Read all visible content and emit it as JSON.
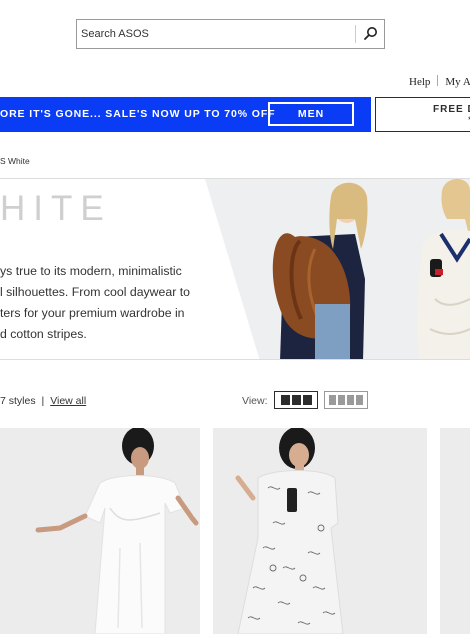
{
  "search": {
    "placeholder": "Search ASOS",
    "icon": "search-icon"
  },
  "utility": {
    "help": "Help",
    "account": "My A"
  },
  "promo": {
    "text": "ORE IT'S GONE... SALE'S NOW UP TO 70% OFF",
    "button": "MEN",
    "color": "#0a3cf5"
  },
  "free_delivery": {
    "title": "FREE D",
    "sub": "*"
  },
  "breadcrumb": "S White",
  "hero": {
    "title": "HITE",
    "description": [
      "ys true to its modern, minimalistic",
      "l silhouettes. From cool daywear to",
      "ters for your premium wardrobe in",
      "d cotton stripes."
    ]
  },
  "toolbar": {
    "styles": "7 styles",
    "separator": "|",
    "view_all": "View all",
    "view_label": "View:"
  },
  "products": [
    {
      "name": "white oversized dress"
    },
    {
      "name": "printed smock dress"
    },
    {
      "name": "product"
    }
  ]
}
